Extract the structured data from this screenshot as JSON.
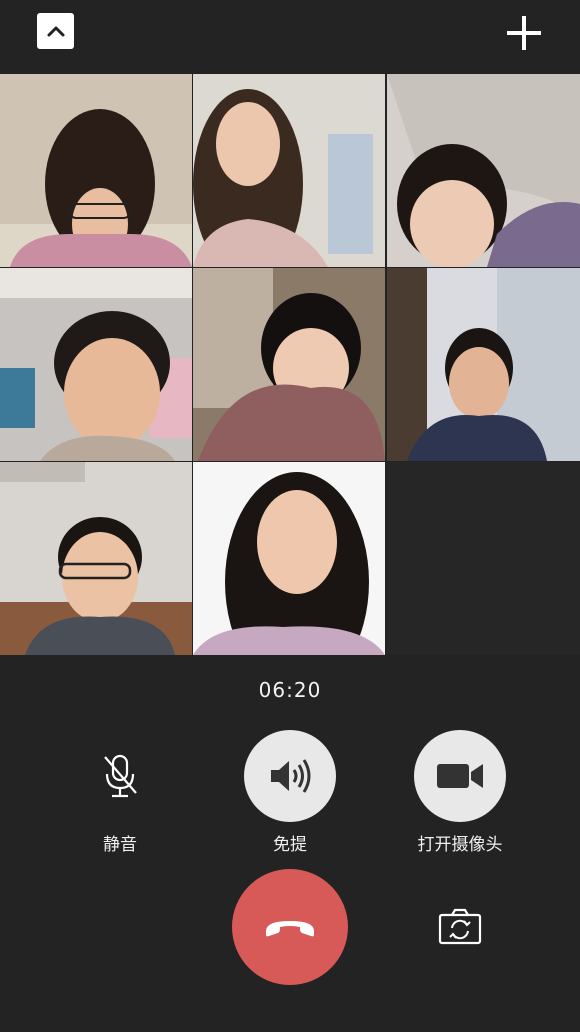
{
  "call": {
    "timer": "06:20",
    "controls": {
      "mute_label": "静音",
      "speaker_label": "免提",
      "camera_label": "打开摄像头"
    }
  },
  "participants": [
    {
      "id": "p1",
      "tile": "woman-pink-glasses"
    },
    {
      "id": "p2",
      "tile": "woman-smiling"
    },
    {
      "id": "p3",
      "tile": "girl-lying"
    },
    {
      "id": "p4",
      "tile": "boy-sweater"
    },
    {
      "id": "p5",
      "tile": "girl-pink-coat"
    },
    {
      "id": "p6",
      "tile": "boy-navy-jacket"
    },
    {
      "id": "p7",
      "tile": "boy-glasses"
    },
    {
      "id": "p8",
      "tile": "woman-long-hair"
    }
  ],
  "colors": {
    "background": "#232323",
    "hangup": "#d75a58",
    "control_circle": "#e8e8e8"
  },
  "icons": [
    "chevron-up-icon",
    "plus-icon",
    "microphone-muted-icon",
    "speaker-icon",
    "video-camera-icon",
    "phone-hangup-icon",
    "switch-camera-icon"
  ]
}
